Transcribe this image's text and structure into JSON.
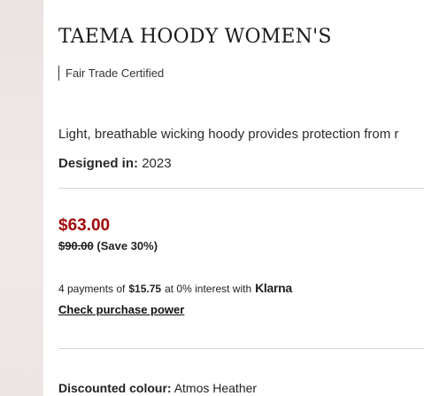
{
  "product": {
    "title": "TAEMA HOODY WOMEN'S",
    "certification": "Fair Trade Certified",
    "description": "Light, breathable wicking hoody provides protection from r",
    "designed_label": "Designed in:",
    "designed_year": "2023"
  },
  "pricing": {
    "sale_price": "$63.00",
    "original_price": "$90.00",
    "savings": "(Save 30%)",
    "sale_color": "#a00a0a"
  },
  "klarna": {
    "prefix": "4 payments of",
    "amount": "$15.75",
    "suffix": "at 0% interest with",
    "logo": "Klarna",
    "link_label": "Check purchase power"
  },
  "colour": {
    "label": "Discounted colour:",
    "value": "Atmos Heather"
  }
}
